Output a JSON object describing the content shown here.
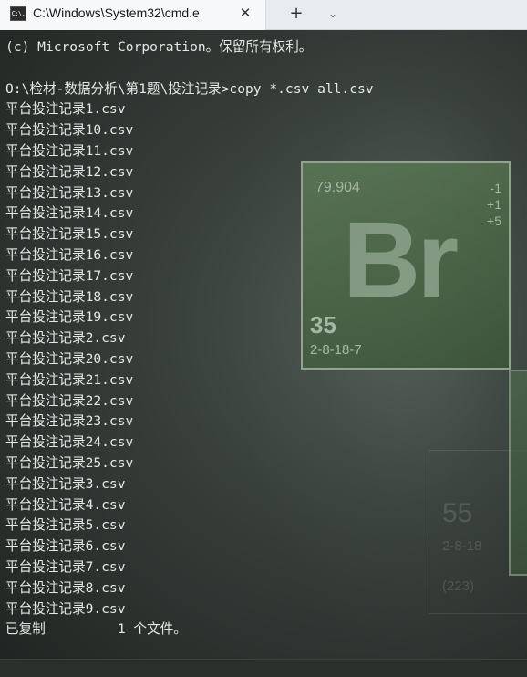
{
  "tab": {
    "icon_label": "C:\\.",
    "title": "C:\\Windows\\System32\\cmd.e",
    "close_symbol": "✕",
    "new_tab_symbol": "+",
    "dropdown_symbol": "⌄"
  },
  "console": {
    "lines": [
      "(c) Microsoft Corporation。保留所有权利。",
      "",
      "O:\\检材-数据分析\\第1题\\投注记录>copy *.csv all.csv",
      "平台投注记录1.csv",
      "平台投注记录10.csv",
      "平台投注记录11.csv",
      "平台投注记录12.csv",
      "平台投注记录13.csv",
      "平台投注记录14.csv",
      "平台投注记录15.csv",
      "平台投注记录16.csv",
      "平台投注记录17.csv",
      "平台投注记录18.csv",
      "平台投注记录19.csv",
      "平台投注记录2.csv",
      "平台投注记录20.csv",
      "平台投注记录21.csv",
      "平台投注记录22.csv",
      "平台投注记录23.csv",
      "平台投注记录24.csv",
      "平台投注记录25.csv",
      "平台投注记录3.csv",
      "平台投注记录4.csv",
      "平台投注记录5.csv",
      "平台投注记录6.csv",
      "平台投注记录7.csv",
      "平台投注记录8.csv",
      "平台投注记录9.csv",
      "已复制         1 个文件。"
    ]
  },
  "wallpaper": {
    "element_mass": "79.904",
    "element_oxidation": "-1\n+1\n+5",
    "element_symbol": "Br",
    "element_number": "35",
    "element_config": "2-8-18-7",
    "faint_number": "55",
    "faint_config": "2-8-18",
    "faint_mass": "(223)"
  },
  "colors": {
    "terminal_text": "#e6e8e6",
    "tab_bar": "#e9ecee",
    "element_green": "#4b6747"
  }
}
